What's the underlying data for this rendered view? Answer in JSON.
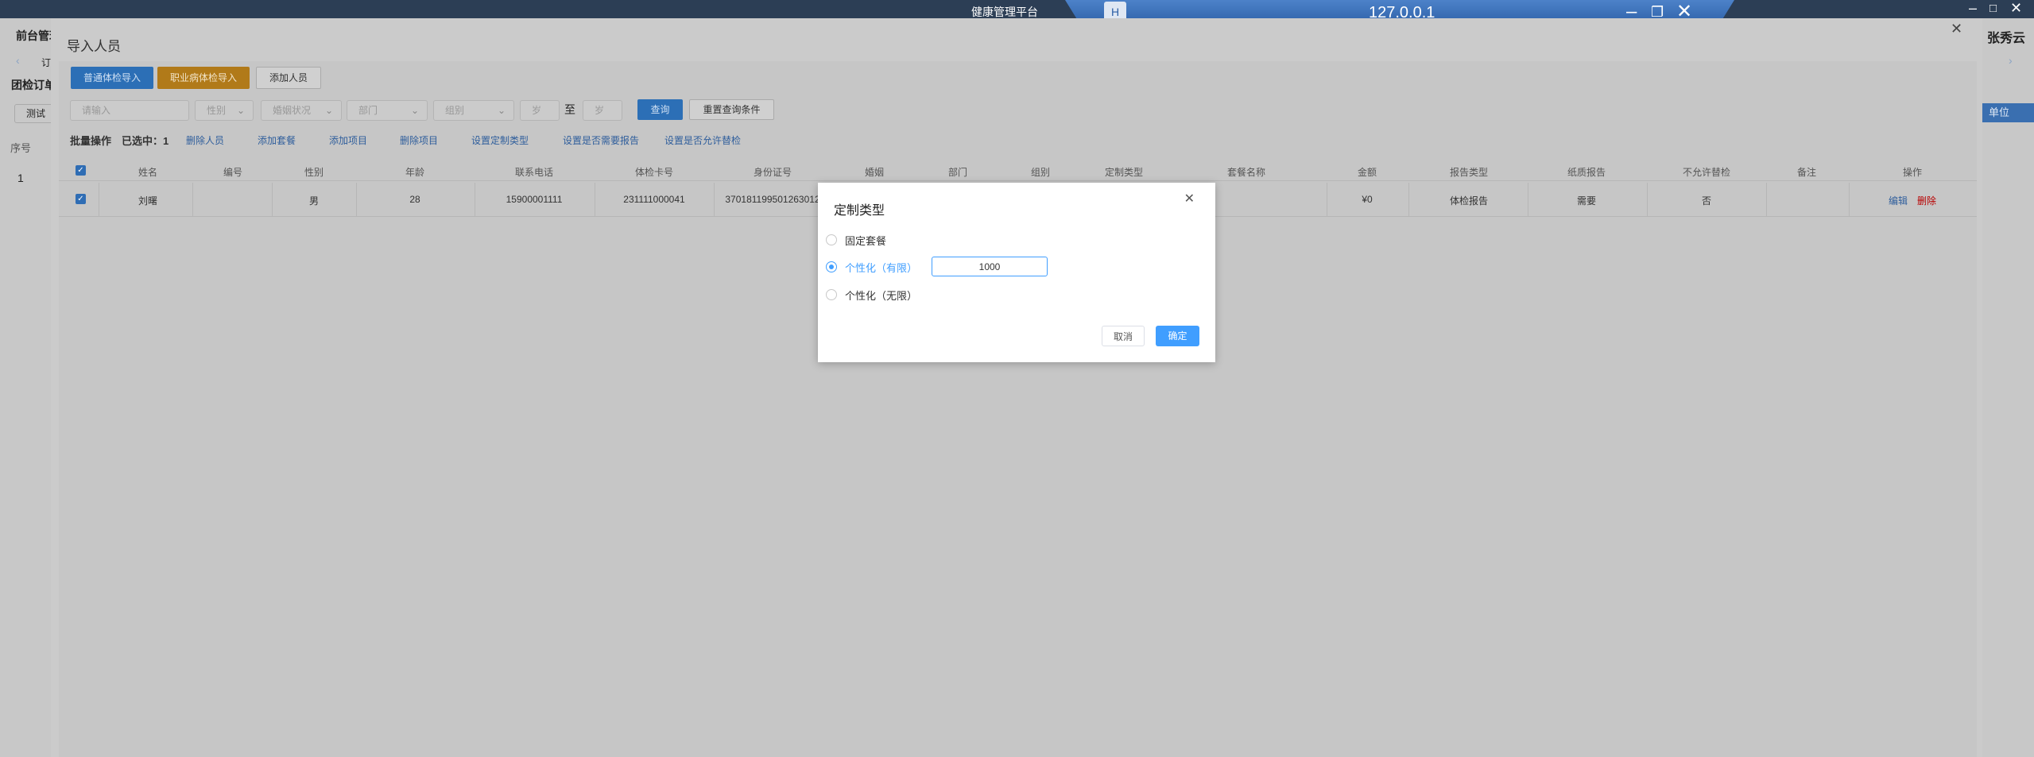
{
  "titlebar": {
    "app_title": "健康管理平台",
    "remote_host": "127.0.0.1",
    "remote_icon": "H"
  },
  "background": {
    "menu_label": "前台管理",
    "order_label": "团检订单",
    "col_seq": "序号",
    "row_seq": "1",
    "user": "张秀云",
    "tab_fragment": "订",
    "test_btn": "测试",
    "unit_btn": "单位"
  },
  "panel": {
    "title": "导入人员",
    "buttons": {
      "normal_import": "普通体检导入",
      "occupational_import": "职业病体检导入",
      "add_person": "添加人员"
    },
    "filters": {
      "name_placeholder": "请输入",
      "gender": "性别",
      "marital": "婚姻状况",
      "department": "部门",
      "group": "组别",
      "age_from": "岁",
      "to": "至",
      "age_to": "岁",
      "search": "查询",
      "reset": "重置查询条件"
    },
    "bulk": {
      "label": "批量操作",
      "selected": "已选中：1",
      "links": [
        "删除人员",
        "添加套餐",
        "添加项目",
        "删除项目",
        "设置定制类型",
        "设置是否需要报告",
        "设置是否允许替检"
      ]
    },
    "table": {
      "columns": [
        "姓名",
        "编号",
        "性别",
        "年龄",
        "联系电话",
        "体检卡号",
        "身份证号",
        "婚姻",
        "部门",
        "组别",
        "定制类型",
        "套餐名称",
        "金额",
        "报告类型",
        "纸质报告",
        "不允许替检",
        "备注",
        "操作"
      ],
      "rows": [
        {
          "name": "刘曙",
          "code": "",
          "gender": "男",
          "age": "28",
          "phone": "15900001111",
          "card": "231111000041",
          "id_no": "370181199501263012",
          "amount": "¥0",
          "report_type": "体检报告",
          "paper_report": "需要",
          "no_substitute": "否",
          "remark": "",
          "edit": "编辑",
          "delete": "删除"
        }
      ]
    }
  },
  "modal": {
    "title": "定制类型",
    "options": [
      {
        "label": "固定套餐",
        "selected": false
      },
      {
        "label": "个性化（有限）",
        "selected": true
      },
      {
        "label": "个性化（无限）",
        "selected": false
      }
    ],
    "limit_value": "1000",
    "cancel": "取消",
    "confirm": "确定"
  }
}
